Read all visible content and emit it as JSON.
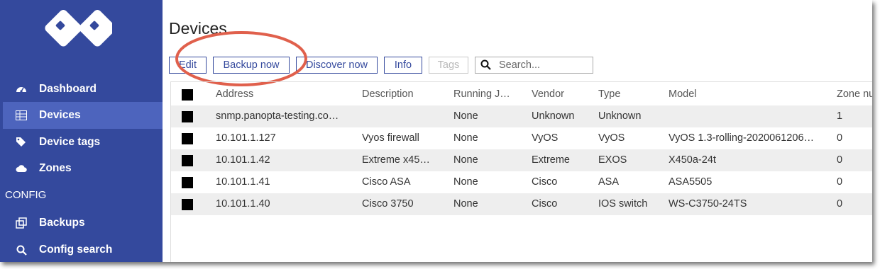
{
  "sidebar": {
    "nav": [
      {
        "label": "Dashboard",
        "icon": "dashboard-gauge-icon"
      },
      {
        "label": "Devices",
        "icon": "table-icon",
        "active": true
      },
      {
        "label": "Device tags",
        "icon": "tags-icon"
      },
      {
        "label": "Zones",
        "icon": "cloud-icon"
      }
    ],
    "section_config": "CONFIG",
    "config_nav": [
      {
        "label": "Backups",
        "icon": "clone-icon"
      },
      {
        "label": "Config search",
        "icon": "search-icon"
      }
    ]
  },
  "page": {
    "title": "Devices"
  },
  "toolbar": {
    "edit": "Edit",
    "backup_now": "Backup now",
    "discover_now": "Discover now",
    "info": "Info",
    "tags": "Tags",
    "search_placeholder": "Search..."
  },
  "table": {
    "columns": [
      "Address",
      "Description",
      "Running J…",
      "Vendor",
      "Type",
      "Model",
      "Zone nu"
    ],
    "rows": [
      [
        "snmp.panopta-testing.co…",
        "",
        "None",
        "Unknown",
        "Unknown",
        "",
        "1"
      ],
      [
        "10.101.1.127",
        "Vyos firewall",
        "None",
        "VyOS",
        "VyOS",
        "VyOS 1.3-rolling-2020061206…",
        "0"
      ],
      [
        "10.101.1.42",
        "Extreme x45…",
        "None",
        "Extreme",
        "EXOS",
        "X450a-24t",
        "0"
      ],
      [
        "10.101.1.41",
        "Cisco ASA",
        "None",
        "Cisco",
        "ASA",
        "ASA5505",
        "0"
      ],
      [
        "10.101.1.40",
        "Cisco 3750",
        "None",
        "Cisco",
        "IOS switch",
        "WS-C3750-24TS",
        "0"
      ]
    ]
  },
  "colors": {
    "sidebar_bg": "#34499d",
    "sidebar_active": "#4d64bd",
    "accent": "#34499d",
    "highlight": "#e0604c"
  }
}
